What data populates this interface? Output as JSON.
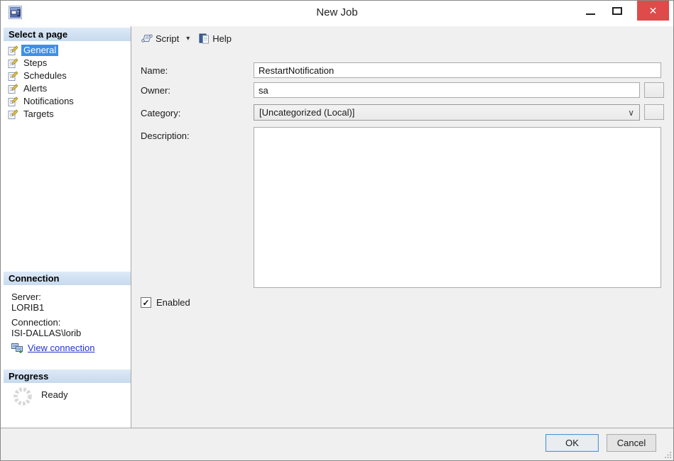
{
  "window": {
    "title": "New Job"
  },
  "icons": {
    "close": "✕",
    "dropdown_arrow": "▾",
    "chevron_down": "∨",
    "check": "✓"
  },
  "colors": {
    "selection_blue": "#3d8fe8",
    "close_red": "#df4a4a",
    "header_blue_top": "#dde9f7",
    "header_blue_bottom": "#c7daee",
    "panel_gray": "#f0f0f0",
    "link_blue": "#2233cc"
  },
  "toolbar": {
    "script_label": "Script",
    "help_label": "Help"
  },
  "sidebar": {
    "select_page": {
      "header": "Select a page",
      "items": [
        {
          "label": "General",
          "selected": true
        },
        {
          "label": "Steps",
          "selected": false
        },
        {
          "label": "Schedules",
          "selected": false
        },
        {
          "label": "Alerts",
          "selected": false
        },
        {
          "label": "Notifications",
          "selected": false
        },
        {
          "label": "Targets",
          "selected": false
        }
      ]
    },
    "connection": {
      "header": "Connection",
      "server_label": "Server:",
      "server_value": "LORIB1",
      "connection_label": "Connection:",
      "connection_value": "ISI-DALLAS\\lorib",
      "view_connection_label": "View connection"
    },
    "progress": {
      "header": "Progress",
      "status": "Ready"
    }
  },
  "form": {
    "name": {
      "label": "Name:",
      "value": "RestartNotification"
    },
    "owner": {
      "label": "Owner:",
      "value": "sa"
    },
    "category": {
      "label": "Category:",
      "value": "[Uncategorized (Local)]"
    },
    "description": {
      "label": "Description:",
      "value": ""
    },
    "enabled": {
      "label": "Enabled",
      "checked": true
    }
  },
  "footer": {
    "ok_label": "OK",
    "cancel_label": "Cancel"
  }
}
